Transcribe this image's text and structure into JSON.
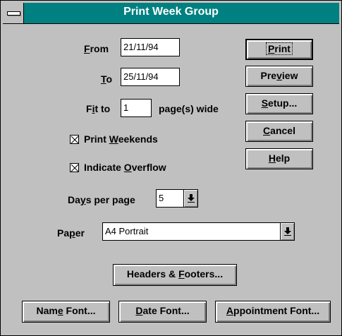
{
  "window": {
    "title": "Print Week Group"
  },
  "fields": {
    "from": {
      "label_pre": "",
      "label_ul": "F",
      "label_post": "rom",
      "value": "21/11/94"
    },
    "to": {
      "label_pre": "",
      "label_ul": "T",
      "label_post": "o",
      "value": "25/11/94"
    },
    "fit": {
      "label_pre": "F",
      "label_ul": "i",
      "label_post": "t to",
      "value": "1",
      "suffix": "page(s) wide"
    }
  },
  "checkboxes": {
    "weekends": {
      "label_pre": "Print ",
      "label_ul": "W",
      "label_post": "eekends",
      "checked": true
    },
    "overflow": {
      "label_pre": "Indicate ",
      "label_ul": "O",
      "label_post": "verflow",
      "checked": true
    }
  },
  "days_per_page": {
    "label_pre": "Da",
    "label_ul": "y",
    "label_post": "s per page",
    "value": "5"
  },
  "paper": {
    "label_pre": "Pa",
    "label_ul": "p",
    "label_post": "er",
    "value": "A4 Portrait"
  },
  "buttons": {
    "print": {
      "pre": "",
      "ul": "P",
      "post": "rint"
    },
    "preview": {
      "pre": "Pre",
      "ul": "v",
      "post": "iew"
    },
    "setup": {
      "pre": "",
      "ul": "S",
      "post": "etup..."
    },
    "cancel": {
      "pre": "",
      "ul": "C",
      "post": "ancel"
    },
    "help": {
      "pre": "",
      "ul": "H",
      "post": "elp"
    },
    "headers": {
      "pre": "Headers & ",
      "ul": "F",
      "post": "ooters..."
    },
    "name_font": {
      "pre": "Nam",
      "ul": "e",
      "post": " Font..."
    },
    "date_font": {
      "pre": "",
      "ul": "D",
      "post": "ate Font..."
    },
    "appt_font": {
      "pre": "",
      "ul": "A",
      "post": "ppointment Font..."
    }
  },
  "colors": {
    "titlebar": "#008080",
    "face": "#c0c0c0"
  },
  "icons": {
    "system_menu": "system-menu-icon",
    "dropdown": "down-arrow-icon",
    "check": "x-check-icon"
  }
}
